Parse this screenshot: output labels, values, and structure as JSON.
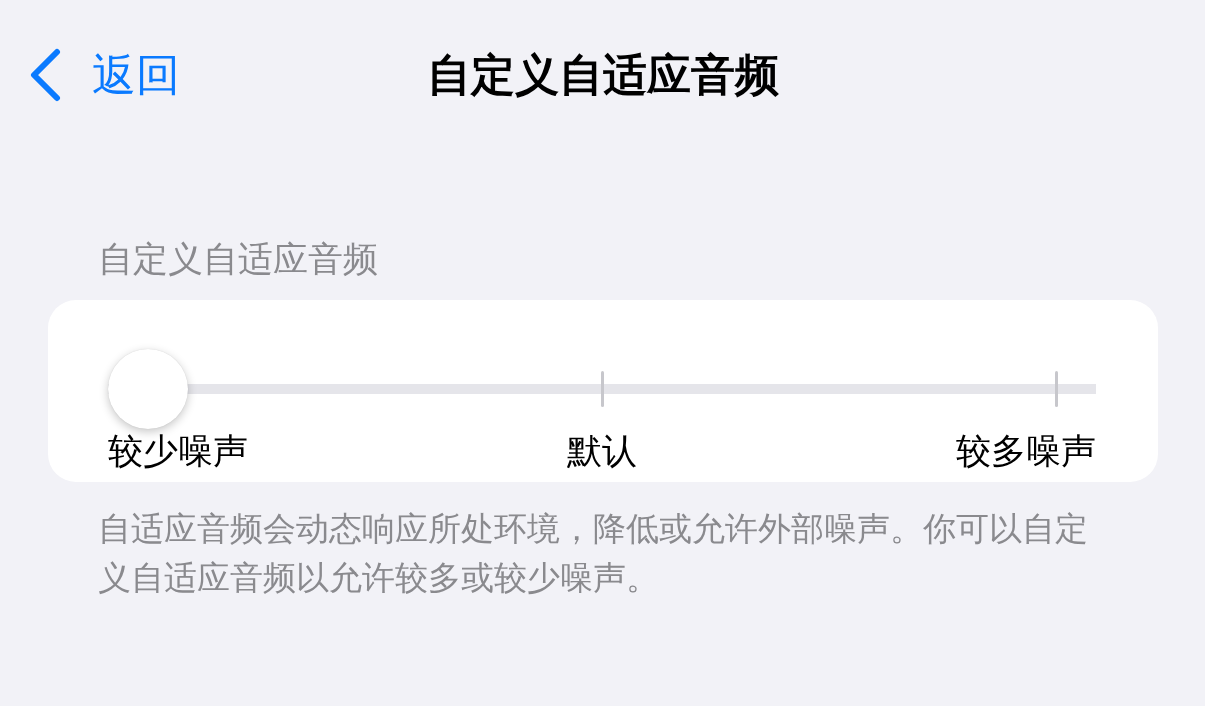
{
  "nav": {
    "back_label": "返回",
    "title": "自定义自适应音频"
  },
  "section": {
    "header": "自定义自适应音频",
    "slider": {
      "level": 0,
      "labels": [
        "较少噪声",
        "默认",
        "较多噪声"
      ]
    },
    "footer": "自适应音频会动态响应所处环境，降低或允许外部噪声。你可以自定义自适应音频以允许较多或较少噪声。"
  }
}
